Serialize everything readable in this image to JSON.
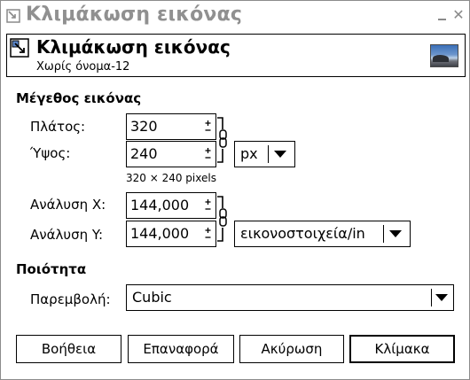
{
  "window": {
    "title": "Κλιμάκωση εικόνας",
    "minimize_icon": "minimize-icon",
    "close_icon": "close-icon"
  },
  "header": {
    "title": "Κλιμάκωση εικόνας",
    "subtitle": "Χωρίς όνομα-12",
    "icon": "scale-tool-icon",
    "thumbnail": "image-thumbnail"
  },
  "image_size": {
    "section_title": "Μέγεθος εικόνας",
    "width_label": "Πλάτος:",
    "width_value": "320",
    "height_label": "Ύψος:",
    "height_value": "240",
    "unit": "px",
    "pixels_info": "320 × 240 pixels",
    "res_x_label": "Ανάλυση X:",
    "res_x_value": "144,000",
    "res_y_label": "Ανάλυση Y:",
    "res_y_value": "144,000",
    "res_unit": "εικονοστοιχεία/in"
  },
  "quality": {
    "section_title": "Ποιότητα",
    "interp_label": "Παρεμβολή:",
    "interp_value": "Cubic"
  },
  "buttons": {
    "help": "Βοήθεια",
    "reset": "Επαναφορά",
    "cancel": "Ακύρωση",
    "scale": "Κλίμακα"
  }
}
